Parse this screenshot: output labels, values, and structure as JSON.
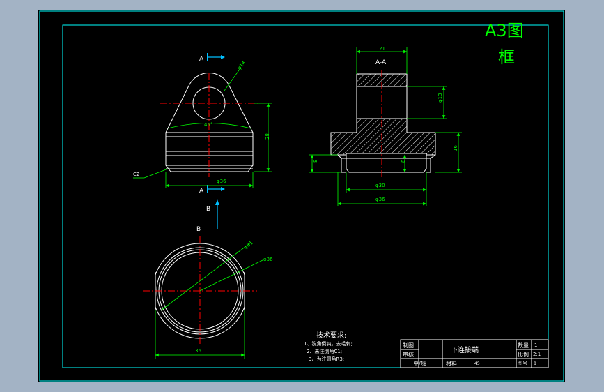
{
  "sheet": {
    "format_label_line1": "A3图",
    "format_label_line2": "框",
    "colors": {
      "background": "#000000",
      "frame": "#00ffff",
      "outline": "#ffffff",
      "hatch": "#ffffff",
      "centerline": "#ff0000",
      "dimension": "#00ff00",
      "title_text": "#00ff00",
      "annotation": "#ffffff",
      "view_marker": "#00bfff",
      "desktop": "#a3b3c5"
    }
  },
  "views": {
    "front": {
      "section_mark_top": "A",
      "section_mark_bottom": "A",
      "dim_hole": "φ14",
      "dim_angle": "45°",
      "dim_height": "28",
      "dim_width": "φ36",
      "dim_chamfer": "C2"
    },
    "section": {
      "title": "A-A",
      "dim_top_width": "21",
      "dim_bore": "φ13",
      "dim_flange_height": "16",
      "dim_left_step": "8",
      "dim_inner_step": "8",
      "dim_inner_dia": "φ30",
      "dim_outer_dia": "φ36"
    },
    "bottom": {
      "view_arrow_label": "B",
      "view_title": "B",
      "dim_inner_dia": "φ31",
      "dim_outer_dia": "φ36",
      "dim_width": "36"
    }
  },
  "notes": {
    "title": "技术要求:",
    "items": [
      "1、锐角倒钝，去毛刺;",
      "2、未注倒角C1;",
      "3、为注圆角R3;"
    ]
  },
  "title_block": {
    "drawn_label": "制图",
    "checked_label": "审核",
    "unit_label": "单/班",
    "part_name": "下连接端",
    "material_label": "材料:",
    "material_value": "45",
    "quantity_label": "数量",
    "quantity_value": "1",
    "scale_label": "比例",
    "scale_value": "2:1",
    "drawing_no_label": "图号",
    "drawing_no_value": "8"
  }
}
